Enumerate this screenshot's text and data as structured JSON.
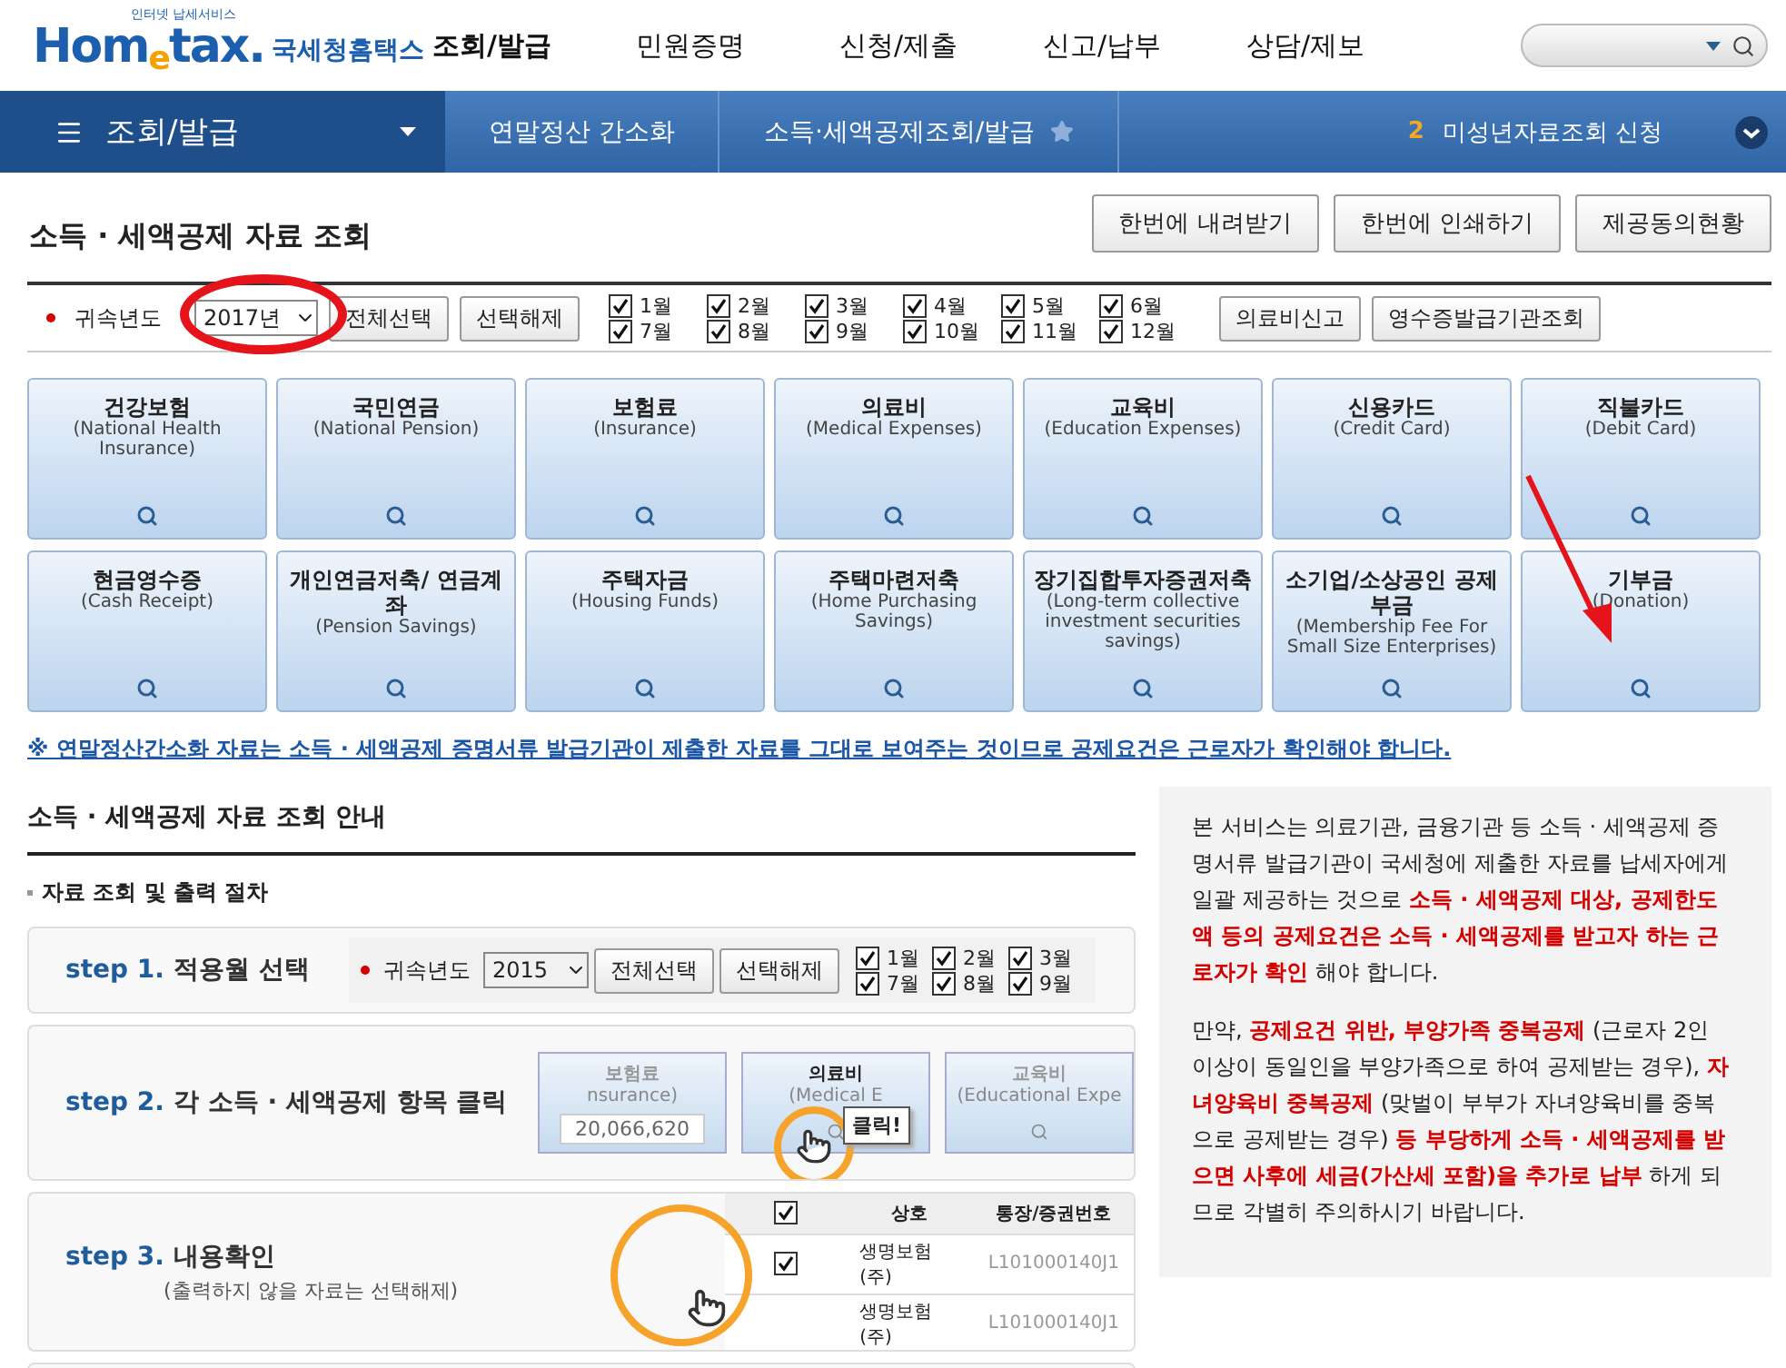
{
  "header": {
    "tagline": "인터넷 납세서비스",
    "brand": "Hom$_{e}$tax.",
    "brand_kr": "국세청홈택스",
    "menu": [
      {
        "label": "조회/발급",
        "selected": true
      },
      {
        "label": "민원증명",
        "selected": false
      },
      {
        "label": "신청/제출",
        "selected": false
      },
      {
        "label": "신고/납부",
        "selected": false
      },
      {
        "label": "상담/제보",
        "selected": false
      }
    ]
  },
  "nav": {
    "section": "조회/발급",
    "crumbs": [
      "연말정산 간소화",
      "소득·세액공제조회/발급"
    ],
    "notice_count": "2",
    "notice": "미성년자료조회 신청"
  },
  "page": {
    "title": "소득 · 세액공제 자료 조회",
    "actions": [
      "한번에 내려받기",
      "한번에 인쇄하기",
      "제공동의현황"
    ]
  },
  "filter": {
    "label": "귀속년도",
    "year": "2017년",
    "buttons": [
      "전체선택",
      "선택해제"
    ],
    "months": [
      {
        "label": "1월",
        "checked": true
      },
      {
        "label": "2월",
        "checked": true
      },
      {
        "label": "3월",
        "checked": true
      },
      {
        "label": "4월",
        "checked": true
      },
      {
        "label": "5월",
        "checked": true
      },
      {
        "label": "6월",
        "checked": true
      },
      {
        "label": "7월",
        "checked": true
      },
      {
        "label": "8월",
        "checked": true
      },
      {
        "label": "9월",
        "checked": true
      },
      {
        "label": "10월",
        "checked": true
      },
      {
        "label": "11월",
        "checked": true
      },
      {
        "label": "12월",
        "checked": true
      }
    ],
    "extra_buttons": [
      "의료비신고",
      "영수증발급기관조회"
    ]
  },
  "tiles": [
    {
      "title": "건강보험",
      "subtitle": "(National Health Insurance)"
    },
    {
      "title": "국민연금",
      "subtitle": "(National Pension)"
    },
    {
      "title": "보험료",
      "subtitle": "(Insurance)"
    },
    {
      "title": "의료비",
      "subtitle": "(Medical Expenses)"
    },
    {
      "title": "교육비",
      "subtitle": "(Education Expenses)"
    },
    {
      "title": "신용카드",
      "subtitle": "(Credit Card)"
    },
    {
      "title": "직불카드",
      "subtitle": "(Debit Card)"
    },
    {
      "title": "현금영수증",
      "subtitle": "(Cash Receipt)"
    },
    {
      "title": "개인연금저축/ 연금계좌",
      "subtitle": "(Pension Savings)"
    },
    {
      "title": "주택자금",
      "subtitle": "(Housing Funds)"
    },
    {
      "title": "주택마련저축",
      "subtitle": "(Home Purchasing Savings)"
    },
    {
      "title": "장기집합투자증권저축",
      "subtitle": "(Long-term collective investment securities savings)"
    },
    {
      "title": "소기업/소상공인 공제부금",
      "subtitle": "(Membership Fee For Small Size Enterprises)"
    },
    {
      "title": "기부금",
      "subtitle": "(Donation)"
    }
  ],
  "notice": "※ 연말정산간소화 자료는 소득 · 세액공제 증명서류 발급기관이 제출한 자료를 그대로 보여주는 것이므로 공제요건은 근로자가 확인해야 합니다.",
  "guide": {
    "title": "소득 · 세액공제 자료 조회 안내",
    "subtitle": "자료 조회 및 출력 절차",
    "step1": {
      "number": "step 1.",
      "title": "적용월 선택",
      "label": "귀속년도",
      "year": "2015",
      "buttons": [
        "전체선택",
        "선택해제"
      ],
      "months": [
        {
          "label": "1월",
          "checked": true
        },
        {
          "label": "2월",
          "checked": true
        },
        {
          "label": "3월",
          "checked": true
        },
        {
          "label": "7월",
          "checked": true
        },
        {
          "label": "8월",
          "checked": true
        },
        {
          "label": "9월",
          "checked": true
        }
      ]
    },
    "step2": {
      "number": "step 2.",
      "title": "각 소득 · 세액공제 항목 클릭",
      "tiles": [
        {
          "title": "보험료",
          "subtitle": "nsurance)",
          "amount": "20,066,620"
        },
        {
          "title": "의료비",
          "subtitle": "(Medical E"
        },
        {
          "title": "교육비",
          "subtitle": "(Educational Expe"
        }
      ],
      "tooltip": "클릭!"
    },
    "step3": {
      "number": "step 3.",
      "title": "내용확인",
      "note": "(출력하지 않을 자료는 선택해제)",
      "columns": [
        "상호",
        "통장/증권번호"
      ],
      "header_checked": true,
      "rows": [
        {
          "checked": true,
          "name": "생명보험(주)",
          "account": "L101000140J1"
        },
        {
          "name": "생명보험(주)",
          "account": "L101000140J1"
        }
      ]
    }
  },
  "info": {
    "paragraphs": [
      "본 서비스는 의료기관, 금융기관 등 소득 · 세액공제 증명서류 발급기관이 국세청에 제출한 자료를 납세자에게 일괄 제공하는 것으로 **소득 · 세액공제 대상, 공제한도액 등의 공제요건은 소득 · 세액공제를 받고자 하는 근로자가 확인** 해야 합니다.",
      "만약, **공제요건 위반, 부양가족 중복공제** (근로자 2인 이상이 동일인을 부양가족으로 하여 공제받는 경우), **자녀양육비 중복공제** (맞벌이 부부가 자녀양육비를 중복으로 공제받는 경우) **등 부당하게 소득 · 세액공제를 받으면 사후에 세금(가산세 포함)을 추가로 납부** 하게 되므로 각별히 주의하시기 바랍니다."
    ]
  }
}
